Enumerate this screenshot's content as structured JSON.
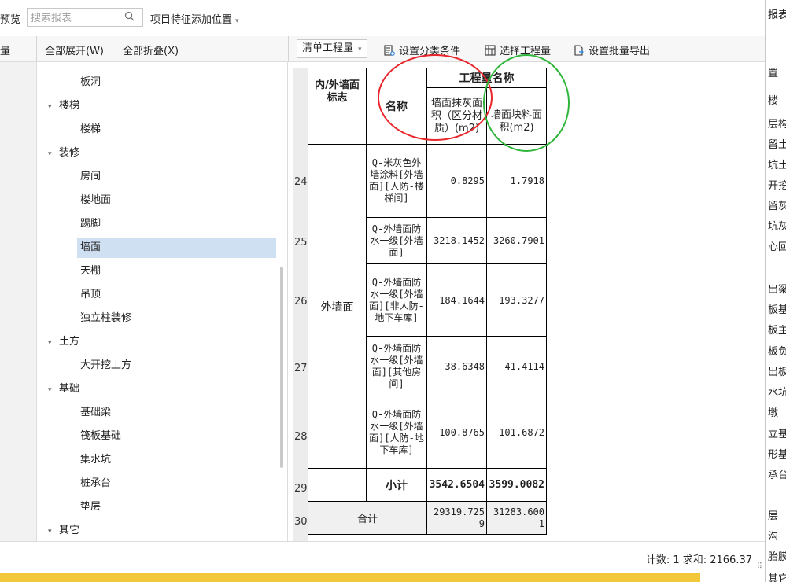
{
  "topbar": {
    "preview_label": "预览",
    "search_placeholder": "搜索报表",
    "search_icon_glyph": "🔍",
    "feature_position": "项目特征添加位置",
    "caret": "▾"
  },
  "toolbar2": {
    "left_label": "量",
    "expand_all": "全部展开(W)",
    "collapse_all": "全部折叠(X)",
    "qty_select": "清单工程量",
    "set_category": "设置分类条件",
    "select_quantity": "选择工程量",
    "batch_export": "设置批量导出"
  },
  "tree": {
    "items": [
      {
        "label": "板洞",
        "level": "child"
      },
      {
        "label": "楼梯",
        "level": "parent"
      },
      {
        "label": "楼梯",
        "level": "child"
      },
      {
        "label": "装修",
        "level": "parent"
      },
      {
        "label": "房间",
        "level": "child"
      },
      {
        "label": "楼地面",
        "level": "child"
      },
      {
        "label": "踢脚",
        "level": "child"
      },
      {
        "label": "墙面",
        "level": "child",
        "selected": true
      },
      {
        "label": "天棚",
        "level": "child"
      },
      {
        "label": "吊顶",
        "level": "child"
      },
      {
        "label": "独立柱装修",
        "level": "child"
      },
      {
        "label": "土方",
        "level": "parent"
      },
      {
        "label": "大开挖土方",
        "level": "child"
      },
      {
        "label": "基础",
        "level": "parent"
      },
      {
        "label": "基础梁",
        "level": "child"
      },
      {
        "label": "筏板基础",
        "level": "child"
      },
      {
        "label": "集水坑",
        "level": "child"
      },
      {
        "label": "桩承台",
        "level": "child"
      },
      {
        "label": "垫层",
        "level": "child"
      },
      {
        "label": "其它",
        "level": "parent"
      }
    ]
  },
  "report": {
    "header_flag": "内/外墙面标志",
    "header_name": "名称",
    "header_group": "工程量名称",
    "col_plaster": "墙面抹灰面积（区分材质）(m2)",
    "col_tile": "墙面块料面积(m2)",
    "group_label": "外墙面",
    "rows": [
      {
        "num": "24",
        "name": "Q-米灰色外墙涂料[外墙面][人防-楼梯间]",
        "plaster": "0.8295",
        "tile": "1.7918"
      },
      {
        "num": "25",
        "name": "Q-外墙面防水一级[外墙面]",
        "plaster": "3218.1452",
        "tile": "3260.7901"
      },
      {
        "num": "26",
        "name": "Q-外墙面防水一级[外墙面][非人防-地下车库]",
        "plaster": "184.1644",
        "tile": "193.3277"
      },
      {
        "num": "27",
        "name": "Q-外墙面防水一级[外墙面][其他房间]",
        "plaster": "38.6348",
        "tile": "41.4114"
      },
      {
        "num": "28",
        "name": "Q-外墙面防水一级[外墙面][人防-地下车库]",
        "plaster": "100.8765",
        "tile": "101.6872"
      }
    ],
    "subtotal": {
      "num": "29",
      "label": "小计",
      "plaster": "3542.6504",
      "tile": "3599.0082"
    },
    "total": {
      "num": "30",
      "label": "合计",
      "plaster": "29319.7259",
      "tile": "31283.6001"
    }
  },
  "right_panel": {
    "items": [
      "报表",
      "置",
      "楼",
      "层构",
      "留土",
      "坑土",
      "开挖",
      "留灰",
      "坑灰",
      "心回",
      "出梁",
      "板基",
      "板主",
      "板负",
      "出板",
      "水坑",
      "墩",
      "立基",
      "形基",
      "承台",
      "层",
      "沟",
      "胎膜",
      "其它"
    ]
  },
  "status": {
    "text": "计数: 1  求和: 2166.37",
    "grip": "⠿"
  },
  "colors": {
    "selection": "#cfe0f3",
    "red_annotation": "#e8262b",
    "green_annotation": "#2fb53a",
    "bottom_strip": "#f3c73a"
  }
}
